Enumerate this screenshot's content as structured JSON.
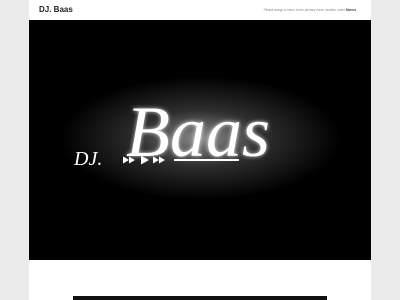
{
  "site": {
    "title": "DJ. Baas"
  },
  "nav": {
    "notice_prefix": "Please assign a menu to the primary menu location under",
    "notice_link": "Menus"
  },
  "hero": {
    "logo_prefix": "DJ.",
    "logo_name": "Baas",
    "controls": [
      "rewind",
      "play",
      "fast-forward"
    ]
  },
  "colors": {
    "page_bg": "#ebebeb",
    "content_bg": "#ffffff",
    "hero_bg": "#000000",
    "logo_fg": "#ffffff"
  }
}
